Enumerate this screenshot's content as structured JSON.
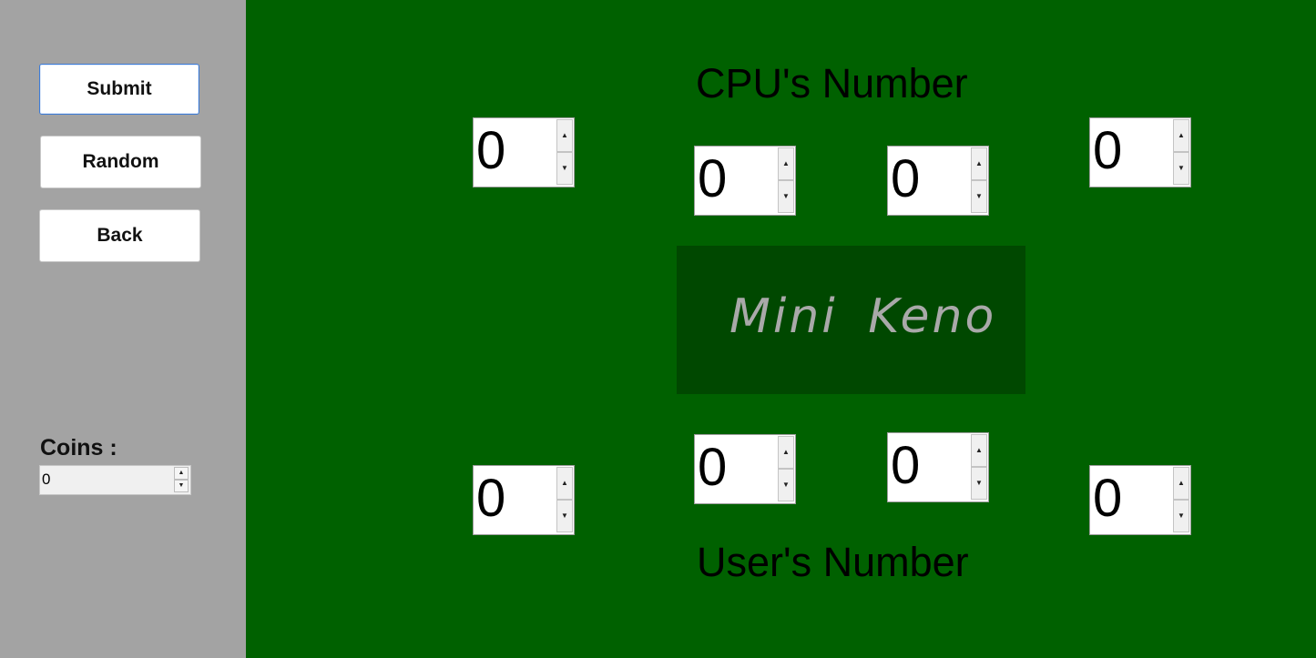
{
  "sidebar": {
    "buttons": {
      "submit": "Submit",
      "random": "Random",
      "back": "Back"
    },
    "coins": {
      "label": "Coins :",
      "value": "0"
    }
  },
  "main": {
    "cpu_heading": "CPU's Number",
    "user_heading": "User's Number",
    "banner_title": "Mini Keno",
    "cpu_numbers": [
      "0",
      "0",
      "0",
      "0"
    ],
    "user_numbers": [
      "0",
      "0",
      "0",
      "0"
    ],
    "arrow_up": "▲",
    "arrow_down": "▼"
  },
  "colors": {
    "sidebar_bg": "#a3a3a3",
    "main_bg": "#006100",
    "banner_bg": "#004800",
    "banner_text": "#a9a9a9"
  }
}
